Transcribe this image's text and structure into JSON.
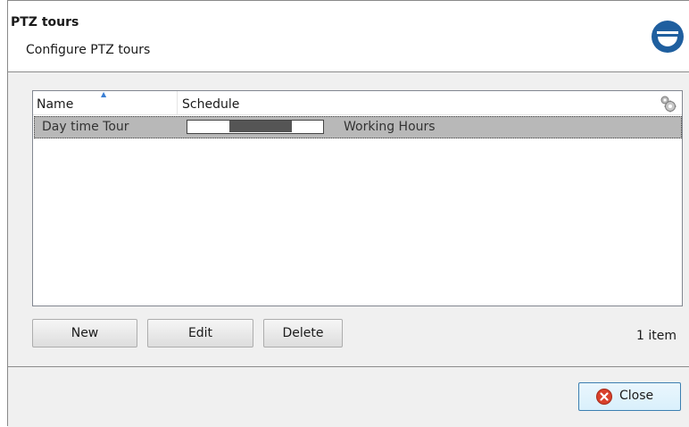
{
  "header": {
    "title": "PTZ tours",
    "subtitle": "Configure PTZ tours",
    "logo_icon": "collapse-circle-icon"
  },
  "list": {
    "columns": [
      {
        "label": "Name",
        "sorted": "ascending"
      },
      {
        "label": "Schedule"
      }
    ],
    "column_chooser_icon": "gear-icon",
    "rows": [
      {
        "name": "Day time Tour",
        "schedule_label": "Working Hours",
        "selected": true
      }
    ]
  },
  "buttons": {
    "new": "New",
    "edit": "Edit",
    "delete": "Delete",
    "close": "Close"
  },
  "status": {
    "item_count": "1 item"
  },
  "colors": {
    "accent": "#1f5f9f",
    "selection": "#b8b8b8",
    "close_icon": "#d9412b"
  }
}
